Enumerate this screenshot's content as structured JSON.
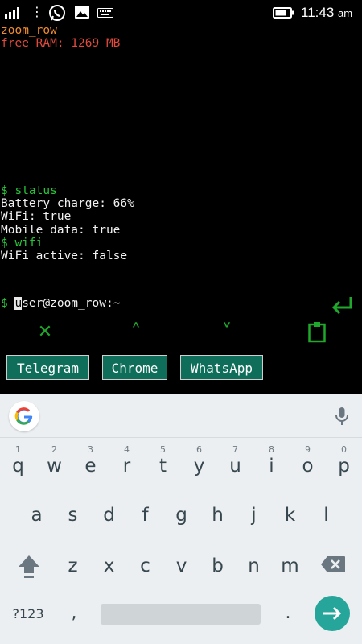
{
  "status_bar": {
    "time": "11:43",
    "ampm": "am",
    "menu_dots": "⋮"
  },
  "terminal": {
    "header_line1": "zoom_row",
    "header_line2": "free RAM: 1269 MB",
    "lines": [
      {
        "text": "$ status",
        "color": "green"
      },
      {
        "text": "Battery charge: 66%",
        "color": "white"
      },
      {
        "text": "WiFi: true",
        "color": "white"
      },
      {
        "text": "Mobile data: true",
        "color": "white"
      },
      {
        "text": "$ wifi",
        "color": "green"
      },
      {
        "text": "WiFi active: false",
        "color": "white"
      }
    ],
    "prompt_symbol": "$",
    "input_cursor_char": "u",
    "input_rest": "ser@zoom_row:~"
  },
  "extra_keys": {
    "close": "✕",
    "up": "˄",
    "down": "˅"
  },
  "shortcuts": [
    "Telegram",
    "Chrome",
    "WhatsApp"
  ],
  "keyboard": {
    "row1": [
      {
        "key": "q",
        "hint": "1"
      },
      {
        "key": "w",
        "hint": "2"
      },
      {
        "key": "e",
        "hint": "3"
      },
      {
        "key": "r",
        "hint": "4"
      },
      {
        "key": "t",
        "hint": "5"
      },
      {
        "key": "y",
        "hint": "6"
      },
      {
        "key": "u",
        "hint": "7"
      },
      {
        "key": "i",
        "hint": "8"
      },
      {
        "key": "o",
        "hint": "9"
      },
      {
        "key": "p",
        "hint": "0"
      }
    ],
    "row2": [
      "a",
      "s",
      "d",
      "f",
      "g",
      "h",
      "j",
      "k",
      "l"
    ],
    "row3": [
      "z",
      "x",
      "c",
      "v",
      "b",
      "n",
      "m"
    ],
    "symbols_label": "?123",
    "comma": ",",
    "period": "."
  },
  "colors": {
    "accent_green": "#27c43a",
    "shortcut_bg": "#0e6e5a",
    "enter_key": "#26a69a"
  }
}
